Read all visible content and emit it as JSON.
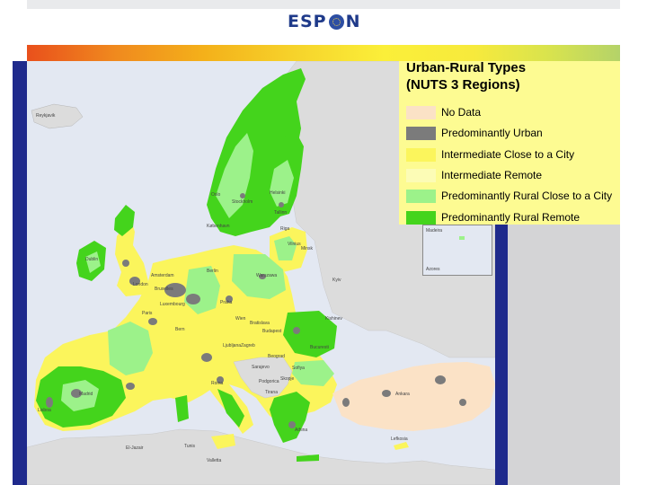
{
  "header": {
    "logo_text_left": "ESP",
    "logo_text_right": "N"
  },
  "legend": {
    "title_line1": "Urban-Rural Types",
    "title_line2": "(NUTS 3 Regions)",
    "items": [
      {
        "label": "No Data",
        "color": "#fbe2c6"
      },
      {
        "label": "Predominantly Urban",
        "color": "#7b7b7b"
      },
      {
        "label": "Intermediate Close to a City",
        "color": "#fbf55c"
      },
      {
        "label": "Intermediate Remote",
        "color": "#fcfcb6"
      },
      {
        "label": "Predominantly Rural Close to a City",
        "color": "#9cf28a"
      },
      {
        "label": "Predominantly Rural Remote",
        "color": "#44d41c"
      }
    ]
  },
  "colors": {
    "sea": "#e3e8f2",
    "non_eu_land": "#dcdcdc",
    "frame_blue": "#1f2a8c"
  },
  "inset": {
    "labels": [
      "Madeira",
      "Azores"
    ]
  },
  "cities": [
    "Reykjavik",
    "Oslo",
    "Stockholm",
    "Helsinki",
    "Tallinn",
    "Riga",
    "Vilnius",
    "Minsk",
    "København",
    "Dublin",
    "London",
    "Amsterdam",
    "Bruxelles",
    "Luxembourg",
    "Paris",
    "Berlin",
    "Warszawa",
    "Praha",
    "Kyiv",
    "Wien",
    "Bratislava",
    "Budapest",
    "Kishinev",
    "Bern",
    "Ljubljana",
    "Zagreb",
    "Beograd",
    "Bucuresti",
    "Sarajevo",
    "Podgorica",
    "Sofiya",
    "Skopje",
    "Tirana",
    "Roma",
    "Madrid",
    "Lisboa",
    "Athina",
    "Ankara",
    "El-Jazair",
    "Tunis",
    "Valletta",
    "Lefkosia"
  ]
}
